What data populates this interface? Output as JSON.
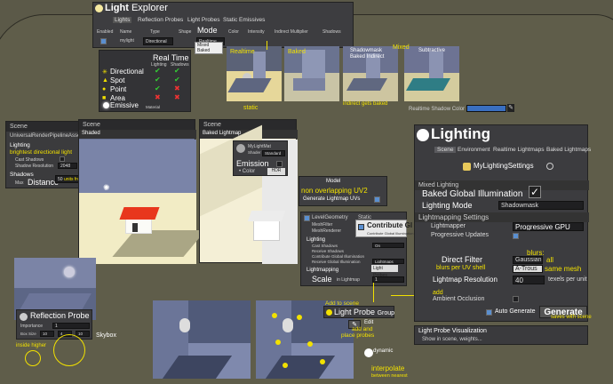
{
  "light_explorer": {
    "title_bold": "Light",
    "title_rest": "Explorer",
    "tabs": [
      "Lights",
      "Reflection Probes",
      "Light Probes",
      "Static Emissives"
    ],
    "columns": [
      "Enabled",
      "Name",
      "Type",
      "Shape",
      "Mode",
      "Color",
      "Intensity",
      "Indirect Multiplier",
      "Shadows"
    ],
    "row": {
      "name": "mylight",
      "type": "Directional"
    },
    "mode_options": [
      "Realtime",
      "Mixed",
      "Baked"
    ],
    "realtime_label": "Real Time",
    "realtime_cols": [
      "Lighting",
      "Shadows"
    ],
    "light_types": [
      "Directional",
      "Spot",
      "Point",
      "Area"
    ],
    "emissive": "Emissive",
    "emissive_sub": "Material"
  },
  "modes": {
    "realtime": "Realtime",
    "baked": "Baked",
    "shadowmask": "Shadowmask",
    "baked_indirect": "Baked Indirect",
    "mixed": "Mixed",
    "subtractive": "Subtractive",
    "static_note": "static",
    "indirect_note": "indirect gets baked",
    "shadow_color_label": "Realtime Shadow Color"
  },
  "urp_panel": {
    "header": "Scene",
    "asset": "UniversalRenderPipelineAsset",
    "lighting_section": "Lighting",
    "brightest_note": "brightest directional light",
    "cast_shadows": "Cast Shadows",
    "shadow_resolution_label": "Shadow Resolution",
    "shadow_resolution_value": "2048",
    "shadows_section": "Shadows",
    "max_label": "Max",
    "distance_label": "Distance",
    "distance_value": "50",
    "distance_note": "units from cam"
  },
  "scene_shaded": {
    "header": "Scene",
    "mode": "Shaded"
  },
  "scene_baked": {
    "header": "Scene",
    "mode": "Baked",
    "mode2": "Lightmap"
  },
  "material": {
    "name": "MyLightMat",
    "shader_label": "Shader",
    "shader_value": "Standard",
    "emission": "Emission",
    "color_label": "Color",
    "hdr": "HDR"
  },
  "model": {
    "title": "Model",
    "uv2_note": "non overlapping UV2",
    "generate_uvs": "Generate Lightmap UVs"
  },
  "inspector": {
    "object": "LevelGeometry",
    "static": "Static",
    "mesh_filter": "MeshFilter",
    "mesh_renderer": "MeshRenderer",
    "contribute_gi": "Contribute GI",
    "contribute_gi_small": "Contribute Global Illumination",
    "lighting": "Lighting",
    "cast_shadows": "Cast Shadows",
    "cast_shadows_value": "On",
    "receive_shadows": "Receive Shadows",
    "contribute_gi_row": "Contribute Global Illumination",
    "receive_gi": "Receive Global Illumination",
    "receive_gi_value": "Lightmaps",
    "light_probes_value": "Light Probes",
    "lightmapping": "Lightmapping",
    "scale": "Scale",
    "scale_sub": "in Lightmap",
    "scale_value": "1"
  },
  "lighting_window": {
    "title": "Lighting",
    "tabs": [
      "Scene",
      "Environment",
      "Realtime Lightmaps",
      "Baked Lightmaps"
    ],
    "settings_asset": "MyLightingSettings",
    "mixed_lighting": "Mixed Lighting",
    "baked_gi": "Baked Global Illumination",
    "lighting_mode_label": "Lighting Mode",
    "lighting_mode_value": "Shadowmask",
    "lightmapping_settings": "Lightmapping Settings",
    "lightmapper_label": "Lightmapper",
    "lightmapper_value": "Progressive GPU",
    "progressive_updates": "Progressive Updates",
    "direct_filter": "Direct Filter",
    "blurs_note": "blurs per UV shell",
    "blurs_title": "blurs:",
    "filter_options": [
      "Gaussian",
      "A-Trous"
    ],
    "all_note": "all",
    "same_mesh_note": "same mesh",
    "lightmap_resolution_label": "Lightmap Resolution",
    "lightmap_resolution_value": "40",
    "texels_unit": "texels per unit",
    "add_note": "add",
    "ambient_occlusion": "Ambient Occlusion",
    "auto_generate": "Auto Generate",
    "generate": "Generate",
    "saves_note": "saves with scene",
    "probe_vis": "Light Probe Visualization",
    "probe_vis_note": "Show in scene, weights..."
  },
  "reflection_probe": {
    "title": "Reflection Probe",
    "importance_label": "Importance",
    "importance_value": "1",
    "box_size_label": "Box Size",
    "box_x": "10",
    "box_y": "4",
    "box_z": "10",
    "inside_higher": "inside higher",
    "skybox": "Skybox"
  },
  "light_probe": {
    "add_to_scene": "Add to scene",
    "title": "Light Probe",
    "title_rest": "Group",
    "edit": "Edit",
    "add_place": "add and",
    "place_probes": "place probes",
    "dynamic": "dynamic",
    "interpolate": "interpolate",
    "between": "between nearest"
  },
  "colors": {
    "accent_yellow": "#f2e100",
    "panel": "#3b3b3d",
    "background": "#5b5948"
  }
}
